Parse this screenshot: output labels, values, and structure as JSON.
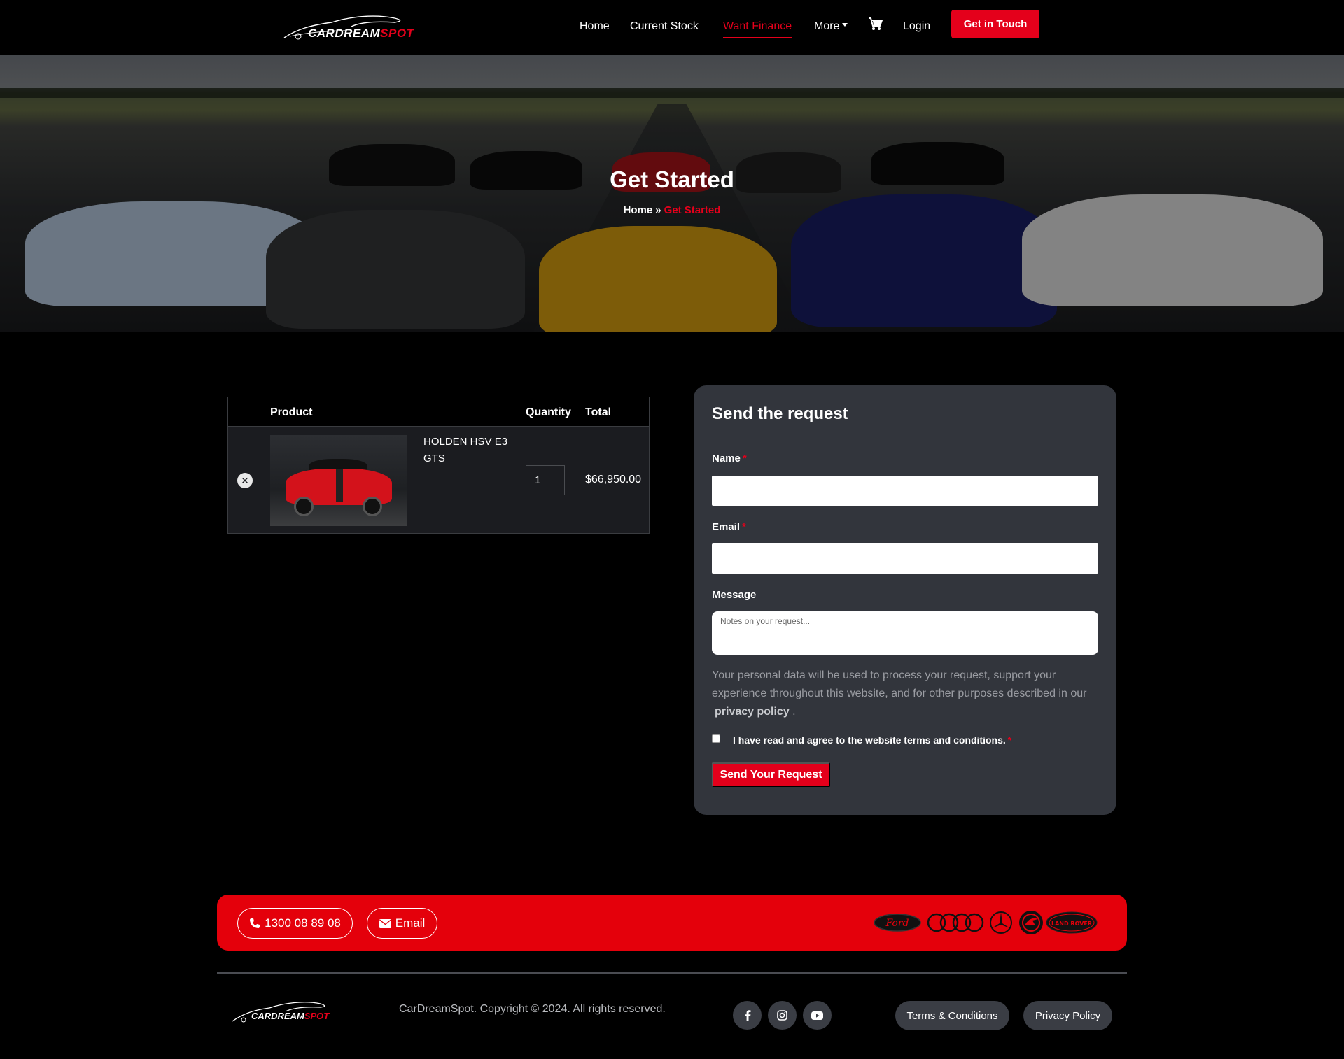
{
  "brand": {
    "logo_left": "CARDREAM",
    "logo_right": "SPOT"
  },
  "nav": {
    "items": [
      {
        "label": "Home"
      },
      {
        "label": "Current Stock"
      },
      {
        "label": "Want Finance",
        "active": true
      },
      {
        "label": "More"
      }
    ],
    "login": "Login",
    "cta": "Get in Touch",
    "cart_icon": "shopping-cart-icon"
  },
  "hero": {
    "title": "Get Started",
    "breadcrumb": {
      "home": "Home",
      "separator": "»",
      "current": "Get Started"
    }
  },
  "cart": {
    "headers": {
      "product": "Product",
      "quantity": "Quantity",
      "total": "Total"
    },
    "items": [
      {
        "name": "HOLDEN HSV E3 GTS",
        "quantity": "1",
        "total": "$66,950.00"
      }
    ]
  },
  "request_form": {
    "title": "Send the request",
    "name_label": "Name",
    "email_label": "Email",
    "message_label": "Message",
    "message_placeholder": "Notes on your request...",
    "required_mark": "*",
    "privacy_text": "Your personal data will be used to process your request, support your experience throughout this website, and for other purposes described in our",
    "privacy_link": "privacy policy",
    "privacy_end": ".",
    "agree_text": "I have read and agree to the website terms and conditions.",
    "submit_label": "Send Your Request"
  },
  "contact_bar": {
    "phone": "1300 08 89 08",
    "email": "Email",
    "brands": [
      "Ford",
      "Audi",
      "Mercedes-Benz",
      "Skoda",
      "LAND ROVER"
    ]
  },
  "footer": {
    "copyright": "CarDreamSpot. Copyright © 2024. All rights reserved.",
    "social": [
      "facebook-icon",
      "instagram-icon",
      "youtube-icon"
    ],
    "terms": "Terms & Conditions",
    "privacy": "Privacy Policy"
  },
  "colors": {
    "accent": "#e4001b",
    "card": "#32353c",
    "background": "#000000"
  }
}
